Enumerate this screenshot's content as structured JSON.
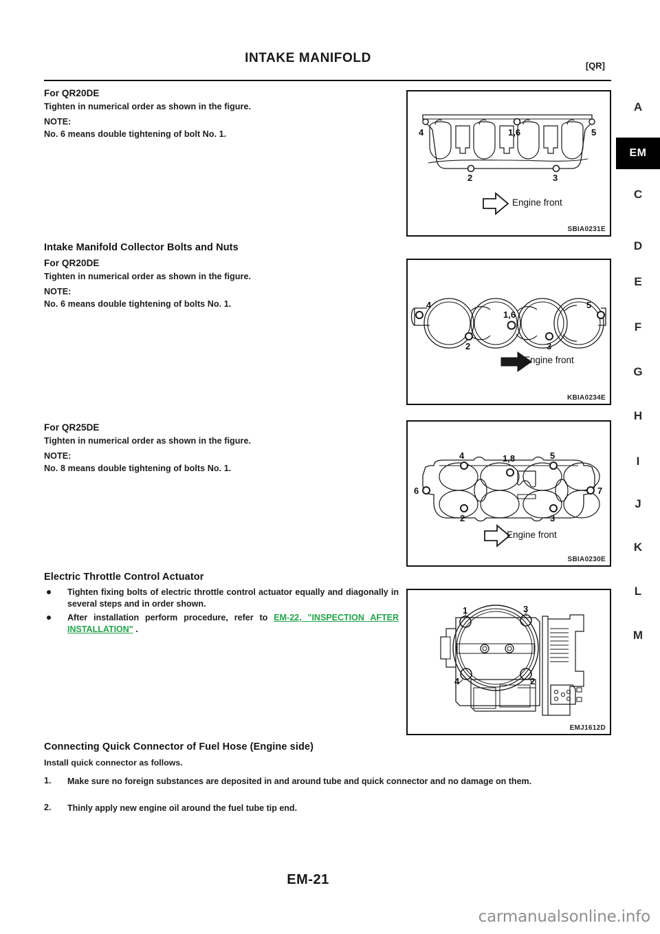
{
  "document": {
    "title": "INTAKE MANIFOLD",
    "section_code": "[QR]",
    "page_number": "EM-21",
    "watermark": "carmanualsonline.info"
  },
  "index_rail": {
    "current": "EM",
    "letters": [
      "A",
      "C",
      "D",
      "E",
      "F",
      "G",
      "H",
      "I",
      "J",
      "K",
      "L",
      "M"
    ]
  },
  "sections": {
    "intake_manifold_bolts": {
      "engine_heading": "For QR20DE",
      "instruction": "Tighten in numerical order as shown in the figure.",
      "note_label": "NOTE:",
      "note_text": "No. 6 means double tightening of bolt No. 1."
    },
    "collector_bolts": {
      "heading": "Intake Manifold Collector Bolts and Nuts",
      "engine_heading": "For QR20DE",
      "instruction": "Tighten in numerical order as shown in the figure.",
      "note_label": "NOTE:",
      "note_text": "No. 6 means double tightening of bolts No. 1."
    },
    "collector_bolts_qr25": {
      "engine_heading": "For QR25DE",
      "instruction": "Tighten in numerical order as shown in the figure.",
      "note_label": "NOTE:",
      "note_text": "No. 8 means double tightening of bolts No. 1."
    },
    "throttle_actuator": {
      "heading": "Electric Throttle Control Actuator",
      "bullet_1": "Tighten fixing bolts of electric throttle control actuator equally and diagonally in several steps and in order shown.",
      "bullet_2_prefix": "After installation perform procedure, refer to ",
      "bullet_2_link": "EM-22, \"INSPECTION AFTER INSTALLATION\"",
      "bullet_2_suffix": " ."
    },
    "quick_connector": {
      "heading": "Connecting Quick Connector of Fuel Hose (Engine side)",
      "intro": "Install quick connector as follows.",
      "steps": [
        {
          "index": "1.",
          "text": "Make sure no foreign substances are deposited in and around tube and quick connector and no damage on them."
        },
        {
          "index": "2.",
          "text": "Thinly apply new engine oil around the fuel tube tip end."
        }
      ]
    }
  },
  "figures": {
    "fig_manifold_gasket": {
      "caption": "SBIA0231E",
      "arrow_label": "Engine front",
      "arrow_style": "hollow",
      "bolt_labels": {
        "top_left": "4",
        "top_center": "1,6",
        "top_right": "5",
        "bottom_left": "2",
        "bottom_right": "3"
      }
    },
    "fig_collector_gasket_qr20": {
      "caption": "KBIA0234E",
      "arrow_label": "Engine front",
      "arrow_style": "solid",
      "bolt_labels": {
        "top_left": "4",
        "top_center": "1,6",
        "top_right": "5",
        "bottom_left": "2",
        "bottom_right": "3"
      }
    },
    "fig_collector_gasket_qr25": {
      "caption": "SBIA0230E",
      "arrow_label": "Engine front",
      "arrow_style": "hollow",
      "bolt_labels": {
        "top_left": "4",
        "top_center": "1,8",
        "top_right": "5",
        "left": "6",
        "right": "7",
        "bottom_left": "2",
        "bottom_right": "3"
      }
    },
    "fig_throttle_body": {
      "caption": "EMJ1612D",
      "bolt_labels": {
        "top_left": "1",
        "top_right": "3",
        "bottom_left": "4",
        "bottom_right": "2"
      }
    }
  }
}
